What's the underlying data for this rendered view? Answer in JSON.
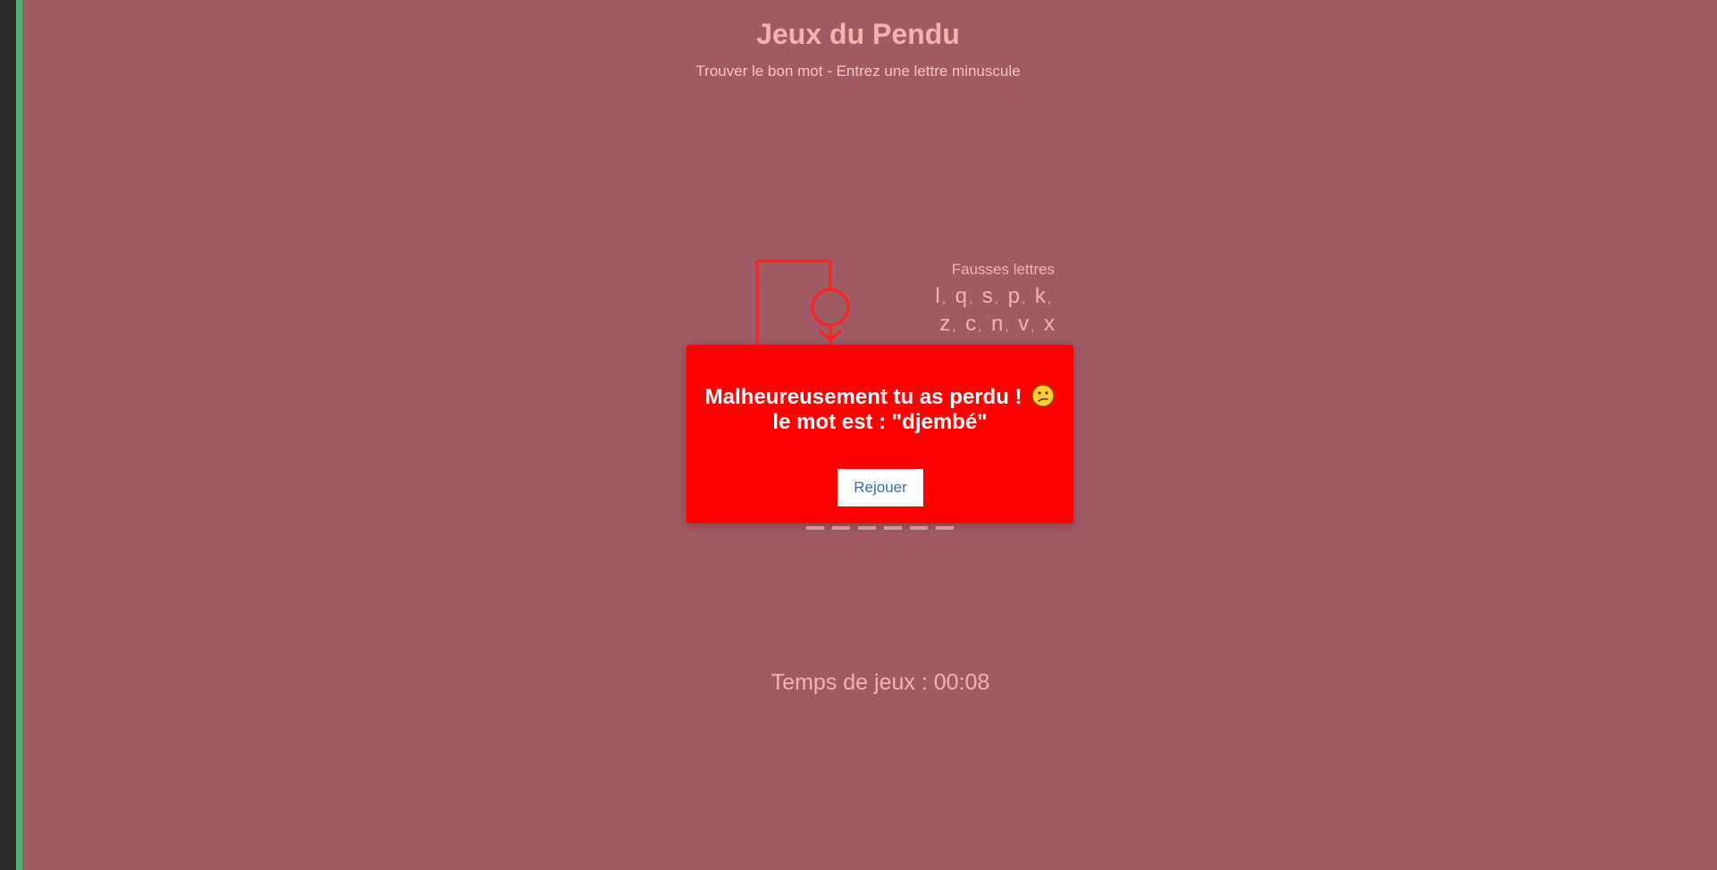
{
  "game": {
    "title": "Jeux du Pendu",
    "subtitle": "Trouver le bon mot - Entrez une lettre minuscule"
  },
  "wrong_letters": {
    "title": "Fausses lettres",
    "row1": [
      "l",
      "q",
      "s",
      "p",
      "k"
    ],
    "row2": [
      "z",
      "c",
      "n",
      "v",
      "x"
    ],
    "separator": ","
  },
  "word": {
    "blank_count": 6
  },
  "timer": {
    "text": "Temps de jeux : 00:08"
  },
  "modal": {
    "line1": "Malheureusement tu as perdu !",
    "emoji": "confused-face-icon",
    "line2": "le mot est : \"djembé\"",
    "button_label": "Rejouer"
  },
  "colors": {
    "background": "#a05a64",
    "accent_text": "#f5b1ae",
    "hangman_stroke": "#ff2020",
    "modal_bg": "#ff0000",
    "left_bar": "#2b2b2b",
    "left_accent": "#4fae72"
  }
}
